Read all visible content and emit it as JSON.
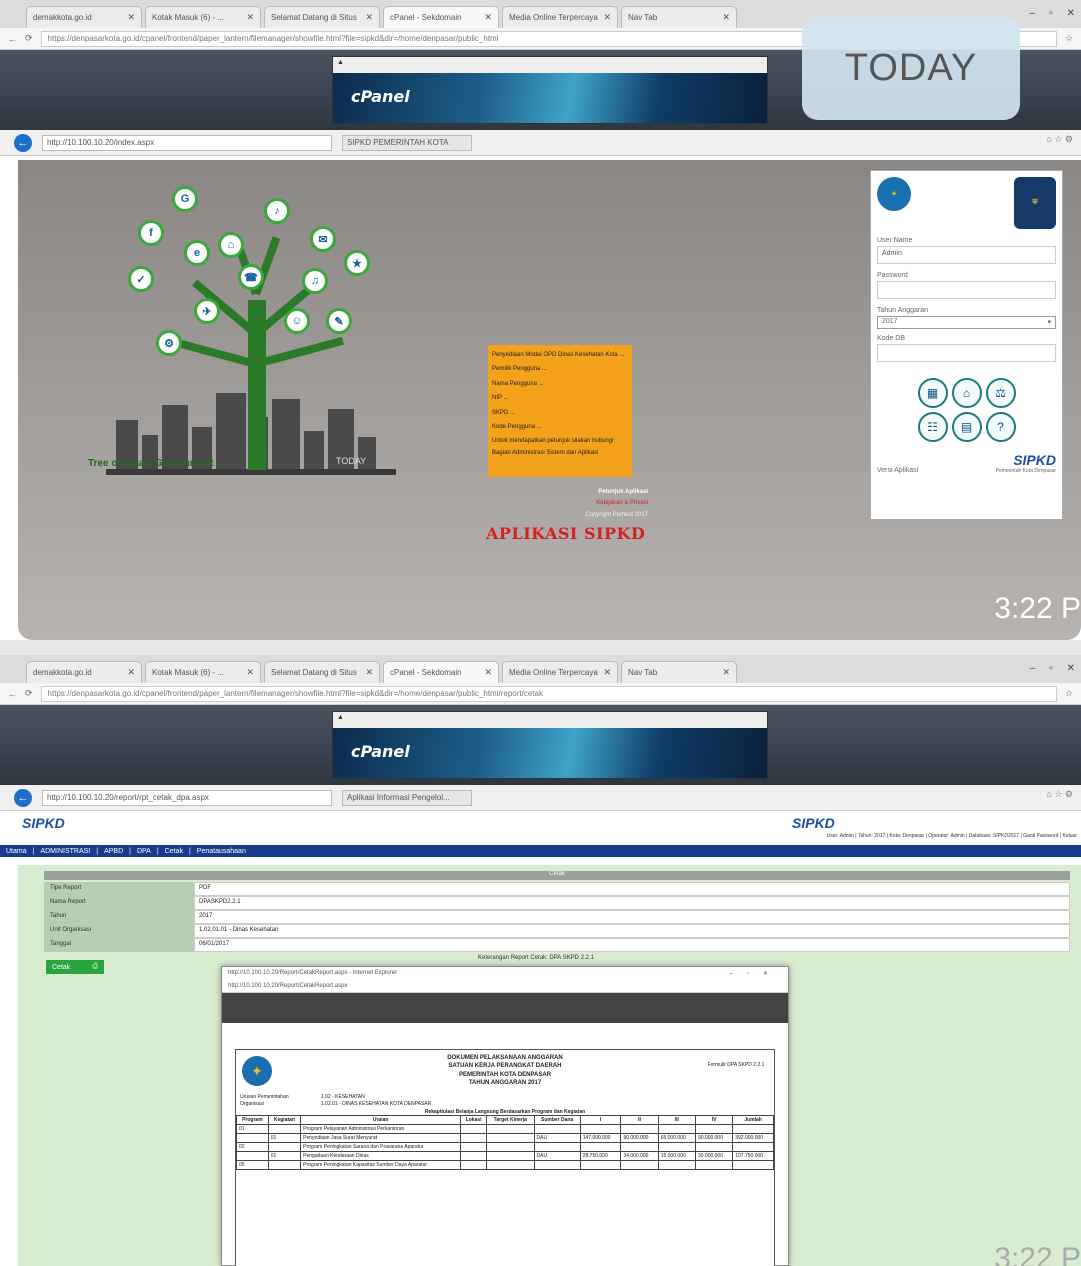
{
  "browser": {
    "tabs": [
      "demakkota.go.id",
      "Kotak Masuk (6) - ...",
      "Selamat Datang di Situs",
      "cPanel - Sekdomain",
      "Media Online Terpercaya",
      "Nav Tab"
    ],
    "url": "https://denpasarkota.go.id/cpanel/frontend/paper_lantern/filemanager/showfile.html?file=sipkd&dir=/home/denpasar/public_html",
    "url2": "https://denpasarkota.go.id/cpanel/frontend/paper_lantern/filemanager/showfile.html?file=sipkd&dir=/home/denpasar/public_html/report/cetak"
  },
  "cpanel": {
    "logo": "cPanel"
  },
  "badge": {
    "today": "TODAY"
  },
  "ie": {
    "address1": "http://10.100.10.20/index.aspx",
    "tab1": "SIPKD PEMERINTAH KOTA",
    "address2": "http://10.100.10.20/report/rpt_cetak_dpa.aspx",
    "tab2": "Aplikasi Informasi Pengelol..."
  },
  "login_screen": {
    "tree_caption": "Tree of Smart Government",
    "tree_caption_small": "TODAY",
    "tree_icons": [
      "G",
      "f",
      "e",
      "♪",
      "✉",
      "⌂",
      "✓",
      "☎",
      "★",
      "♫",
      "✈",
      "☺",
      "⚙",
      "✎"
    ],
    "info_lines": [
      "Penyediaan Modal OPD Dinas Kesehatan Kota ...",
      "Pemilik Pengguna ...",
      "Nama Pengguna ...",
      "NIP ...",
      "SKPD ...",
      "Kode Pengguna ...",
      "Untuk mendapatkan petunjuk silakan hubungi Bagian Administrasi Sistem dan Aplikasi"
    ],
    "footer_links": [
      "Petunjuk Aplikasi",
      "Kebijakan & Privasi",
      "Copyright Pemkot 2017"
    ],
    "app_title": "APLIKASI SIPKD"
  },
  "login_panel": {
    "user_label": "User Name",
    "user_value": "Admin",
    "password_label": "Password",
    "year_label": "Tahun Anggaran",
    "year_value": "2017",
    "db_label": "Kode DB",
    "version": "Versi Aplikasi",
    "logo_main": "SIPKD",
    "logo_sub": "Pemerintah Kota Denpasar"
  },
  "clock": {
    "time": "3:22 P"
  },
  "sipkd": {
    "logo": "SIPKD",
    "logo_center": "SIPKD",
    "top_links": "User: Admin | Tahun: 2017 | Kota: Denpasar | Operator: Admin | Database: SIPKD2017 | Ganti Password | Keluar",
    "nav": [
      "Utama",
      "ADMINISTRASI",
      "APBD",
      "DPA",
      "Cetak",
      "Penatausahaan"
    ],
    "form_title": "Cetak",
    "fields": [
      {
        "label": "Tipe Report",
        "value": "PDF"
      },
      {
        "label": "Nama Report",
        "value": "DPASKPD2.2.1"
      },
      {
        "label": "Tahun",
        "value": "2017"
      },
      {
        "label": "Unit Organisasi",
        "value": "1.02.01.01 - Dinas Kesehatan"
      },
      {
        "label": "Tanggal",
        "value": "06/01/2017"
      }
    ],
    "status_text": "Keterangan Report Cetak: DPA SKPD 2.2.1",
    "cetak_label": "Cetak",
    "popup_title": "http://10.100.10.20/Report/CetakReport.aspx - Internet Explorer",
    "popup_addr": "http://10.100.10.20/Report/CetakReport.aspx",
    "doc_title_lines": [
      "DOKUMEN PELAKSANAAN ANGGARAN",
      "SATUAN KERJA PERANGKAT DAERAH",
      "PEMERINTAH KOTA DENPASAR",
      "TAHUN ANGGARAN 2017"
    ],
    "doc_code": "Formulir DPA SKPD 2.2.1",
    "doc_labels": [
      "Urusan Pemerintahan",
      "Organisasi"
    ],
    "doc_values": [
      "1.02 - KESEHATAN",
      "1.02.01 - DINAS KESEHATAN KOTA DENPASAR"
    ],
    "doc_subtitle": "Rekapitulasi Belanja Langsung Berdasarkan Program dan Kegiatan",
    "doc_headers": [
      "Program",
      "Kegiatan",
      "Uraian",
      "Lokasi",
      "Target Kinerja",
      "Sumber Dana",
      "I",
      "II",
      "III",
      "IV",
      "Jumlah"
    ],
    "doc_rows": [
      [
        "01",
        "",
        "Program Pelayanan Administrasi Perkantoran",
        "",
        "",
        "",
        "",
        "",
        "",
        "",
        ""
      ],
      [
        "",
        "01",
        "Penyediaan Jasa Surat Menyurat",
        "",
        "",
        "DAU",
        "147.000.000",
        "90.000.000",
        "65.000.000",
        "90.000.000",
        "392.000.000"
      ],
      [
        "02",
        "",
        "Program Peningkatan Sarana dan Prasarana Aparatur",
        "",
        "",
        "",
        "",
        "",
        "",
        "",
        ""
      ],
      [
        "",
        "01",
        "Pengadaan Kendaraan Dinas",
        "",
        "",
        "DAU",
        "28.750.000",
        "34.000.000",
        "15.000.000",
        "30.000.000",
        "107.750.000"
      ],
      [
        "05",
        "",
        "Program Peningkatan Kapasitas Sumber Daya Aparatur",
        "",
        "",
        "",
        "",
        "",
        "",
        "",
        ""
      ]
    ]
  },
  "colors": {
    "accent": "#f4a21b",
    "brand": "#173e8c",
    "title_red": "#d42020",
    "tree": "#2a7a2a"
  }
}
